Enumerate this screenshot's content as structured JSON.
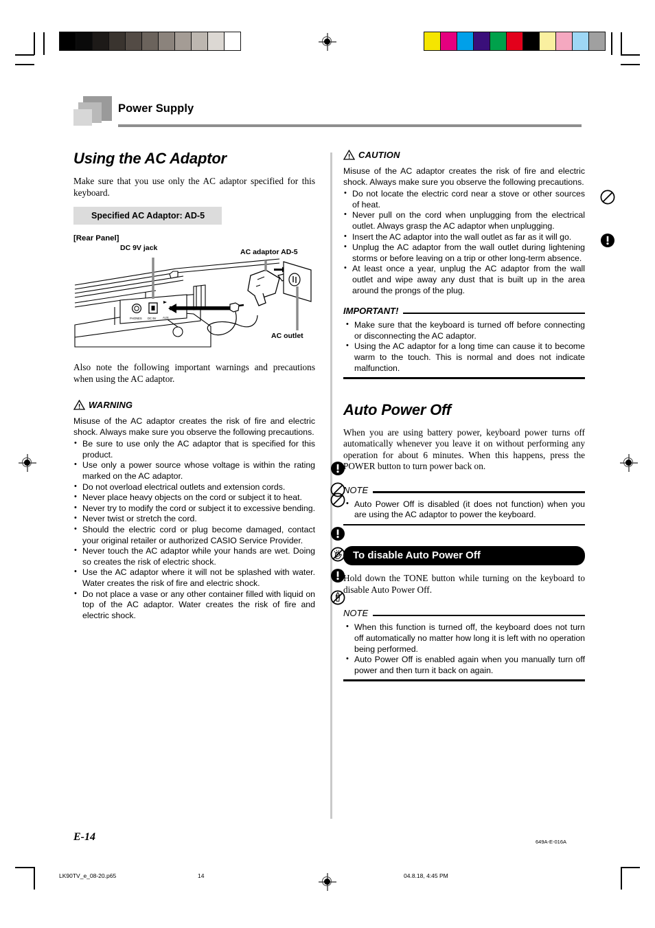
{
  "header": {
    "title": "Power Supply"
  },
  "left": {
    "section_title": "Using the AC Adaptor",
    "intro": "Make sure that you use only the AC adaptor specified for this keyboard.",
    "spec_box": "Specified AC Adaptor: AD-5",
    "rear_panel_label": "[Rear Panel]",
    "diagram": {
      "dc_jack_label": "DC 9V jack",
      "adaptor_label": "AC adaptor AD-5",
      "outlet_label": "AC outlet"
    },
    "also_note": "Also note the following important warnings and precautions when using the AC adaptor.",
    "warning": {
      "title": "WARNING",
      "icon": "warning-triangle-icon",
      "body": "Misuse of the AC adaptor creates the risk of fire and electric shock. Always make sure you observe the following precautions.",
      "items": [
        {
          "text": "Be sure to use only the AC adaptor that is specified for this product.",
          "icon": ""
        },
        {
          "text": "Use only a power source whose voltage is within the rating marked on the AC adaptor.",
          "icon": "exclamation-icon"
        },
        {
          "text": "Do not overload electrical outlets and extension cords.",
          "icon": "prohibition-icon"
        },
        {
          "text": "Never place heavy objects on the cord or subject it to heat.",
          "icon": "prohibition-icon"
        },
        {
          "text": "Never try to modify the cord or subject it to excessive bending.",
          "icon": ""
        },
        {
          "text": "Never twist or stretch the cord.",
          "icon": ""
        },
        {
          "text": "Should the electric cord or plug become damaged, contact your original retailer or authorized CASIO Service Provider.",
          "icon": "exclamation-icon"
        },
        {
          "text": "Never touch the AC adaptor while your hands are wet. Doing so creates the risk of electric shock.",
          "icon": "no-wet-hands-icon"
        },
        {
          "text": "Use the AC adaptor where it will not be splashed with water. Water creates the risk of fire and electric shock.",
          "icon": "exclamation-icon"
        },
        {
          "text": "Do not place a vase or any other container filled with liquid on top of the AC adaptor. Water creates the risk of fire and electric shock.",
          "icon": "no-liquid-icon"
        }
      ]
    }
  },
  "right": {
    "caution": {
      "title": "CAUTION",
      "icon": "warning-triangle-icon",
      "body": "Misuse of the AC adaptor creates the risk of fire and electric shock. Always make sure you observe the following precautions.",
      "items": [
        {
          "text": "Do not locate the electric cord near a stove or other sources of heat.",
          "icon": "prohibition-icon"
        },
        {
          "text": "Never pull on the cord when unplugging from the electrical outlet.  Always grasp the AC adaptor when unplugging.",
          "icon": ""
        },
        {
          "text": "Insert the AC adaptor into the wall outlet as far as it will go.",
          "icon": "exclamation-icon"
        },
        {
          "text": "Unplug the AC adaptor from the wall outlet during lightening storms or before leaving on a trip or other long-term absence.",
          "icon": ""
        },
        {
          "text": "At least once a year, unplug the AC adaptor from the wall outlet and wipe away any dust that is built up in the area around the prongs of the plug.",
          "icon": ""
        }
      ]
    },
    "important": {
      "label": "IMPORTANT!",
      "items": [
        "Make sure that the keyboard is turned off before connecting or disconnecting the AC adaptor.",
        "Using the AC adaptor for a long time can cause it to become warm to the touch. This is normal and does not indicate malfunction."
      ]
    },
    "auto_power_off": {
      "title": "Auto Power Off",
      "body": "When you are using battery power, keyboard power turns off automatically whenever you leave it on without performing any operation for about 6 minutes. When this happens, press the POWER button to turn power back on.",
      "note_label": "NOTE",
      "note_items": [
        "Auto Power Off is disabled (it does not function) when you are using the AC adaptor to power the keyboard."
      ]
    },
    "disable": {
      "banner": "To disable Auto Power Off",
      "body": "Hold down the TONE button while turning on the keyboard to disable Auto Power Off.",
      "note_label": "NOTE",
      "note_items": [
        "When this function is turned off, the keyboard does not turn off automatically no matter how long it is left with no operation being performed.",
        "Auto Power Off is enabled again when you manually turn off power and then turn it back on again."
      ]
    }
  },
  "footer": {
    "page_number": "E-14",
    "doc_code": "649A-E-016A",
    "file_name": "LK90TV_e_08-20.p65",
    "sheet_number": "14",
    "print_timestamp": "04.8.18, 4:45 PM"
  },
  "print_marks": {
    "gray_wedge": [
      "#000000",
      "#0a0a0a",
      "#1d1a18",
      "#3a342f",
      "#534b45",
      "#6b635c",
      "#8b837c",
      "#a49c95",
      "#bdb7b0",
      "#dcd8d3",
      "#ffffff"
    ],
    "color_bar": [
      "#f5e500",
      "#e5007f",
      "#00a0e9",
      "#3a0f7a",
      "#00a14b",
      "#e3001b",
      "#000000",
      "#faf0a0",
      "#f5a8c0",
      "#9ed7f5",
      "#a0a0a0"
    ]
  }
}
